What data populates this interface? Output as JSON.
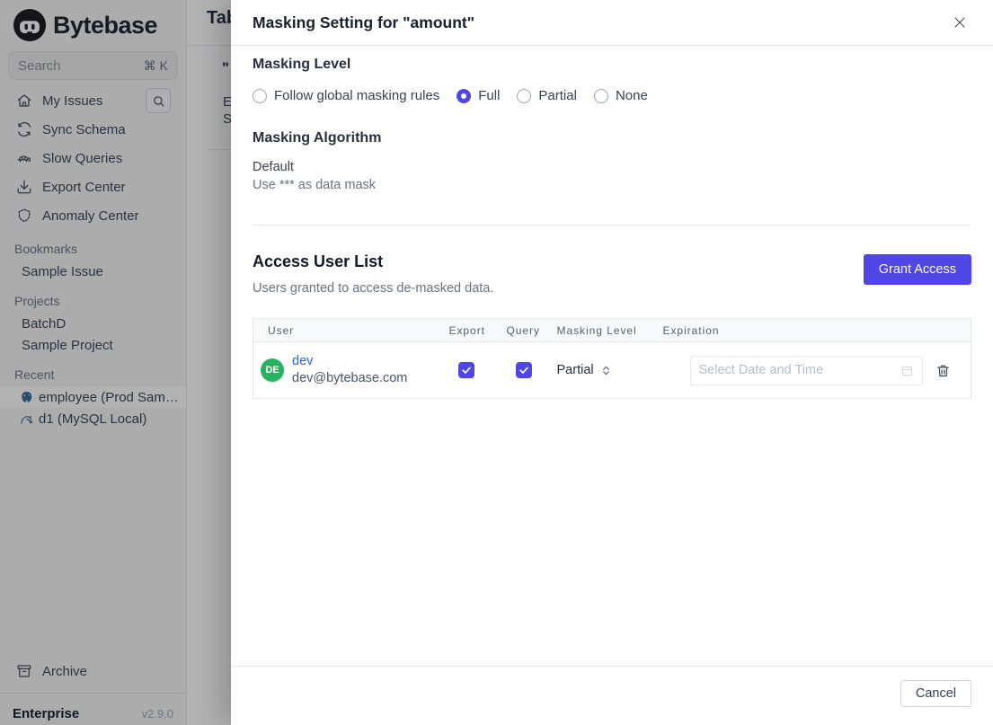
{
  "sidebar": {
    "brand": "Bytebase",
    "search_placeholder": "Search",
    "search_shortcut": "⌘ K",
    "nav_items": [
      {
        "label": "My Issues",
        "icon": "home-icon"
      },
      {
        "label": "Sync Schema",
        "icon": "sync-icon"
      },
      {
        "label": "Slow Queries",
        "icon": "turtle-icon"
      },
      {
        "label": "Export Center",
        "icon": "download-icon"
      },
      {
        "label": "Anomaly Center",
        "icon": "shield-icon"
      }
    ],
    "sections": [
      {
        "title": "Bookmarks",
        "items": [
          {
            "label": "Sample Issue"
          }
        ]
      },
      {
        "title": "Projects",
        "items": [
          {
            "label": "BatchD"
          },
          {
            "label": "Sample Project"
          }
        ]
      },
      {
        "title": "Recent",
        "items": [
          {
            "label": "employee (Prod Sam…",
            "icon": "postgres-icon",
            "selected": true
          },
          {
            "label": "d1 (MySQL Local)",
            "icon": "mysql-icon",
            "selected": false
          }
        ]
      }
    ],
    "archive_label": "Archive",
    "plan": "Enterprise",
    "version": "v2.9.0"
  },
  "page_behind": {
    "title_fragment": "Tab",
    "fragment_quote": "\"",
    "fragment_line1": "E",
    "fragment_line2": "S"
  },
  "dialog": {
    "title": "Masking Setting for \"amount\"",
    "masking_level": {
      "heading": "Masking Level",
      "options": [
        {
          "label": "Follow global masking rules",
          "checked": false
        },
        {
          "label": "Full",
          "checked": true
        },
        {
          "label": "Partial",
          "checked": false
        },
        {
          "label": "None",
          "checked": false
        }
      ]
    },
    "masking_algorithm": {
      "heading": "Masking Algorithm",
      "value": "Default",
      "description": "Use *** as data mask"
    },
    "access": {
      "heading": "Access User List",
      "subtitle": "Users granted to access de-masked data.",
      "grant_button_label": "Grant Access",
      "table": {
        "headers": [
          "User",
          "Export",
          "Query",
          "Masking Level",
          "Expiration"
        ],
        "rows": [
          {
            "avatar_initials": "DE",
            "avatar_color": "#27b35f",
            "name": "dev",
            "email": "dev@bytebase.com",
            "export_allowed": true,
            "query_allowed": true,
            "masking_level": "Partial",
            "expiration_value": "",
            "expiration_placeholder": "Select Date and Time"
          }
        ]
      }
    },
    "cancel_label": "Cancel"
  },
  "colors": {
    "accent": "#4f46e5",
    "link": "#2563eb"
  }
}
